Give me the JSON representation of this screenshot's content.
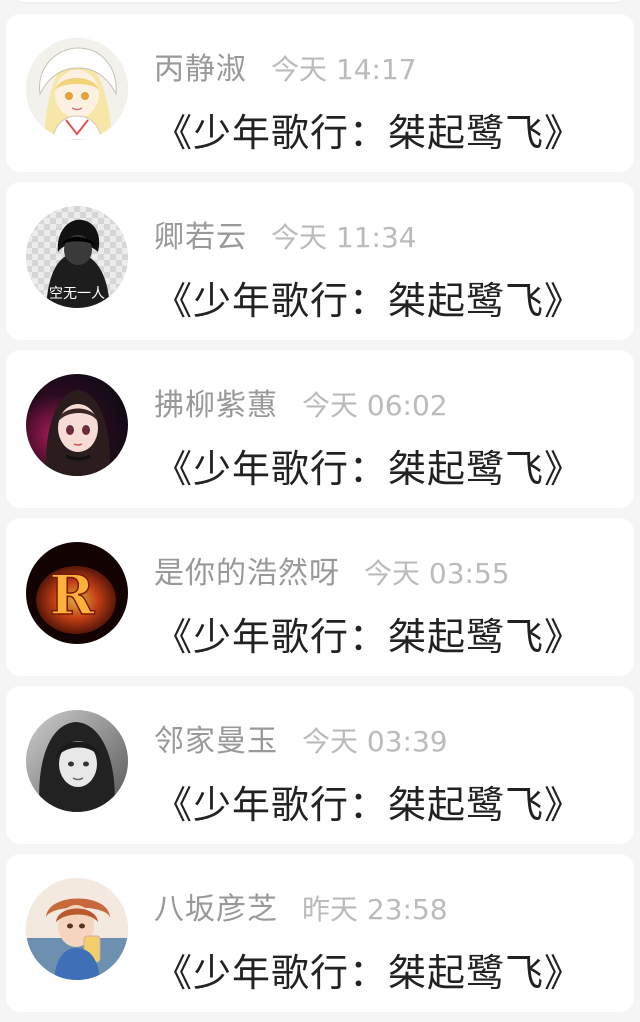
{
  "messages": [
    {
      "name": "丙静淑",
      "time": "今天 14:17",
      "text": "《少年歌行：桀起鹭飞》",
      "avatar_icon": "anime-girl-avatar"
    },
    {
      "name": "卿若云",
      "time": "今天 11:34",
      "text": "《少年歌行：桀起鹭飞》",
      "avatar_icon": "dark-figure-avatar",
      "avatar_text": "空无一人"
    },
    {
      "name": "拂柳紫蕙",
      "time": "今天 06:02",
      "text": "《少年歌行：桀起鹭飞》",
      "avatar_icon": "anime-girl-dark-avatar"
    },
    {
      "name": "是你的浩然呀",
      "time": "今天 03:55",
      "text": "《少年歌行：桀起鹭飞》",
      "avatar_icon": "fire-letter-avatar",
      "avatar_text": "R"
    },
    {
      "name": "邻家曼玉",
      "time": "今天 03:39",
      "text": "《少年歌行：桀起鹭飞》",
      "avatar_icon": "bw-photo-avatar"
    },
    {
      "name": "八坂彦芝",
      "time": "昨天 23:58",
      "text": "《少年歌行：桀起鹭飞》",
      "avatar_icon": "photo-girl-drink-avatar"
    }
  ],
  "colors": {
    "name": "#999999",
    "time": "#bbbbbb",
    "message": "#222222",
    "background": "#f5f5f5",
    "card": "#ffffff"
  }
}
